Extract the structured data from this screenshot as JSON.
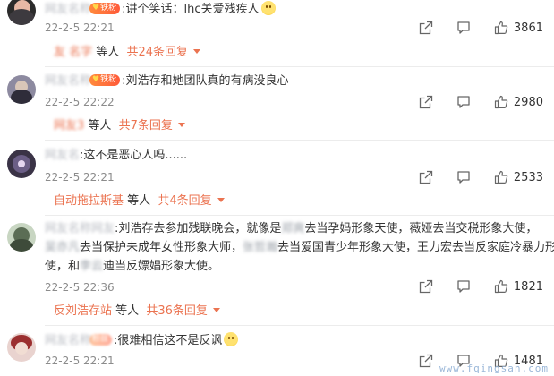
{
  "comments": [
    {
      "badge": "铁粉",
      "text": ":讲个笑话：lhc关爱残疾人",
      "date": "22-2-5 22:21",
      "likes": "3861",
      "replies": {
        "who_suffix": "等人",
        "total": "共24条回复"
      }
    },
    {
      "badge": "铁粉",
      "text": ":刘浩存和她团队真的有病没良心",
      "date": "22-2-5 22:22",
      "likes": "2980",
      "replies": {
        "who_suffix": "等人",
        "total": "共7条回复"
      }
    },
    {
      "text": ":这不是恶心人吗......",
      "date": "22-2-5 22:21",
      "likes": "2533",
      "replies": {
        "who": "自动拖拉斯基",
        "who_suffix": "等人",
        "total": "共4条回复"
      }
    },
    {
      "text_line1": ":刘浩存去参加残联晚会，就像是",
      "text_line1b": "去当孕妈形象天使，薇娅去当交税形象大使，",
      "text_line2": "去当保护未成年女性形象大师，",
      "text_line2b": "去当爱国青少年形象大使，王力宏去当反家庭冷暴力形象大",
      "text_line3": "使，和",
      "text_line3b": "迪当反嫖娼形象大使。",
      "date": "22-2-5 22:36",
      "likes": "1821",
      "replies": {
        "who": "反刘浩存站",
        "who_suffix": "等人",
        "total": "共36条回复"
      }
    },
    {
      "text": ":很难相信这不是反讽",
      "date": "22-2-5 22:21",
      "likes": "1481"
    }
  ],
  "watermark": "www.fqingsan.com",
  "colors": {
    "accent": "#eb7350",
    "badge": "#ff6a3a",
    "meta": "#8c8c8c"
  },
  "icons": [
    "share-icon",
    "comment-icon",
    "like-icon",
    "chevron-down-icon"
  ]
}
